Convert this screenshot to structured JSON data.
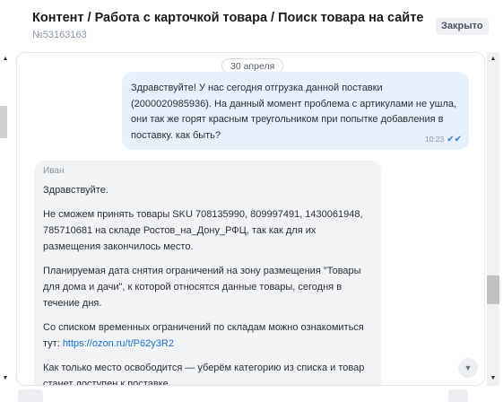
{
  "header": {
    "title": "Контент / Работа с карточкой товара / Поиск товара на сайте",
    "ticket_id": "№53163163",
    "status": "Закрыто"
  },
  "chat": {
    "date": "30 апреля",
    "outgoing": {
      "text": "Здравствуйте! У нас сегодня отгрузка данной поставки (2000020985936). На данный момент проблема с артикулами не ушла, они так же горят красным треугольником при попытке добавления в поставку. как быть?",
      "time": "10:23",
      "read_icon": "double-check-icon"
    },
    "incoming": {
      "sender": "Иван",
      "p1": "Здравствуйте.",
      "p2": "Не сможем принять товары SKU 708135990, 809997491, 1430061948, 785710681 на складе Ростов_на_Дону_РФЦ, так как для их размещения закончилось место.",
      "p3": "Планируемая дата снятия ограничений на зону размещения \"Товары для дома и дачи\", к которой относятся данные товары, сегодня в течение дня.",
      "p4_text": "Со списком временных ограничений по складам можно ознакомиться тут: ",
      "p4_link": "https://ozon.ru/t/P62y3R2",
      "p5": "Как только место освободится — уберём категорию из списка и товар станет доступен к поставке."
    }
  },
  "icons": {
    "scroll_up": "chevron-up-icon",
    "scroll_down": "chevron-down-icon"
  },
  "colors": {
    "outgoing_bubble": "#e6f0fb",
    "incoming_bubble": "#f1f3f5",
    "link": "#1a6fd6"
  }
}
